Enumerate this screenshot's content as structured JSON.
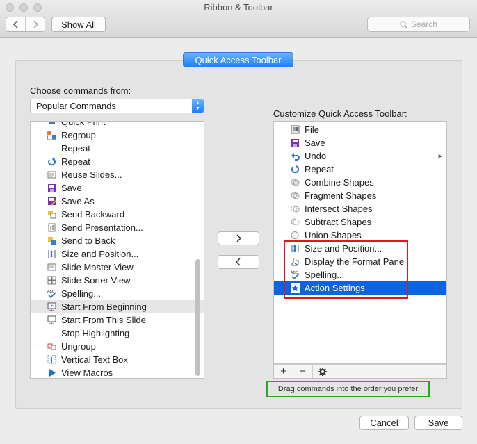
{
  "window": {
    "title": "Ribbon & Toolbar"
  },
  "toolbar": {
    "show_all_label": "Show All",
    "search_placeholder": "Search"
  },
  "tab": {
    "label": "Quick Access Toolbar"
  },
  "left": {
    "choose_label": "Choose commands from:",
    "selected_source": "Popular Commands",
    "items": [
      {
        "label": "Quick Print",
        "icon": "printer-icon"
      },
      {
        "label": "Regroup",
        "icon": "regroup-icon"
      },
      {
        "label": "Repeat",
        "icon": ""
      },
      {
        "label": "Repeat",
        "icon": "repeat-icon"
      },
      {
        "label": "Reuse Slides...",
        "icon": "reuse-slides-icon"
      },
      {
        "label": "Save",
        "icon": "save-icon"
      },
      {
        "label": "Save As",
        "icon": "save-as-icon"
      },
      {
        "label": "Send Backward",
        "icon": "send-backward-icon"
      },
      {
        "label": "Send Presentation...",
        "icon": "send-presentation-icon"
      },
      {
        "label": "Send to Back",
        "icon": "send-to-back-icon"
      },
      {
        "label": "Size and Position...",
        "icon": "size-position-icon"
      },
      {
        "label": "Slide Master View",
        "icon": "slide-master-icon"
      },
      {
        "label": "Slide Sorter View",
        "icon": "slide-sorter-icon"
      },
      {
        "label": "Spelling...",
        "icon": "spelling-icon"
      },
      {
        "label": "Start From Beginning",
        "icon": "start-beginning-icon"
      },
      {
        "label": "Start From This Slide",
        "icon": "start-this-slide-icon"
      },
      {
        "label": "Stop Highlighting",
        "icon": ""
      },
      {
        "label": "Ungroup",
        "icon": "ungroup-icon"
      },
      {
        "label": "Vertical Text Box",
        "icon": "vertical-text-box-icon"
      },
      {
        "label": "View Macros",
        "icon": "play-macro-icon"
      }
    ]
  },
  "right": {
    "customize_label": "Customize Quick Access Toolbar:",
    "items": [
      {
        "label": "File",
        "icon": "file-icon"
      },
      {
        "label": "Save",
        "icon": "save-icon"
      },
      {
        "label": "Undo",
        "icon": "undo-icon"
      },
      {
        "label": "Repeat",
        "icon": "repeat-icon"
      },
      {
        "label": "Combine Shapes",
        "icon": "combine-shapes-icon"
      },
      {
        "label": "Fragment Shapes",
        "icon": "fragment-shapes-icon"
      },
      {
        "label": "Intersect Shapes",
        "icon": "intersect-shapes-icon"
      },
      {
        "label": "Subtract Shapes",
        "icon": "subtract-shapes-icon"
      },
      {
        "label": "Union Shapes",
        "icon": "union-shapes-icon"
      },
      {
        "label": "Size and Position...",
        "icon": "size-position-icon"
      },
      {
        "label": "Display the Format Pane",
        "icon": "format-pane-icon"
      },
      {
        "label": "Spelling...",
        "icon": "spelling-icon"
      },
      {
        "label": "Action Settings",
        "icon": "action-settings-icon"
      }
    ],
    "hint": "Drag commands into the order you prefer"
  },
  "buttons": {
    "cancel": "Cancel",
    "save": "Save"
  },
  "colors": {
    "accent": "#1a82fb",
    "selection": "#0b63e0",
    "red_outline": "#e8141b",
    "green_outline": "#2ea326"
  }
}
